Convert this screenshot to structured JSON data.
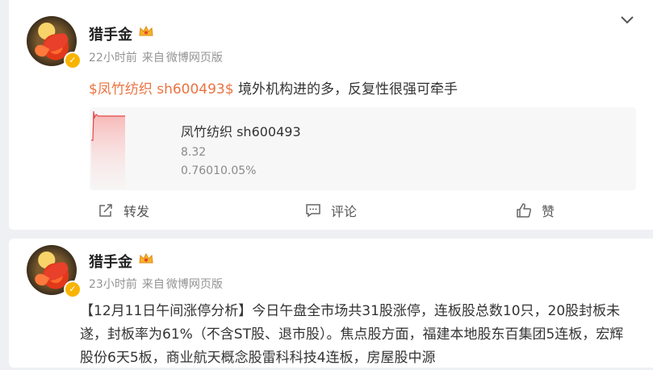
{
  "posts": [
    {
      "username": "猎手金",
      "time": "22小时前",
      "source_prefix": "来自",
      "source": "微博网页版",
      "tag": "$凤竹纺织 sh600493$",
      "text": " 境外机构进的多，反复性很强可牵手",
      "stock": {
        "name": "凤竹纺织 sh600493",
        "price": "8.32",
        "change": "0.76010.05%"
      },
      "actions": {
        "repost": "转发",
        "comment": "评论",
        "like": "赞"
      }
    },
    {
      "username": "猎手金",
      "time": "23小时前",
      "source_prefix": "来自",
      "source": "微博网页版",
      "body": "【12月11日午间涨停分析】今日午盘全市场共31股涨停，连板股总数10只，20股封板未遂，封板率为61%（不含ST股、退市股）。焦点股方面，福建本地股东百集团5连板，宏辉股份6天5板，商业航天概念股雷科科技4连板，房屋股中源"
    }
  ],
  "colors": {
    "accent": "#eb7340",
    "meta": "#939393",
    "card_bg": "#ffffff",
    "page_bg": "#eef0f3"
  },
  "icons": [
    "chevron-down-icon",
    "crown-badge-icon",
    "verified-badge-icon",
    "repost-icon",
    "comment-icon",
    "like-icon"
  ]
}
